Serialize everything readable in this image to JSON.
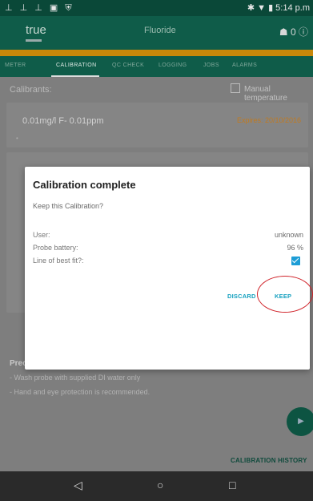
{
  "status_bar": {
    "left_icons": "⊥ ⊥ ⊥ ▣ ⛨",
    "right_text": "✱ ▼ ▮ 5:14 p.m"
  },
  "app_bar": {
    "logo": "true",
    "title": "Fluoride",
    "actions": "☗ 0  ⓘ"
  },
  "tabs": [
    {
      "label": "METER"
    },
    {
      "label": "CALIBRATION"
    },
    {
      "label": "QC CHECK"
    },
    {
      "label": "LOGGING"
    },
    {
      "label": "JOBS"
    },
    {
      "label": "ALARMS"
    }
  ],
  "content": {
    "calibrants_label": "Calibrants:",
    "manual_temperature_label": "Manual temperature",
    "calibrant_text": "0.01mg/l F- 0.01ppm",
    "calibrant_expiry": "Expires: 20/10/2016",
    "precautions_title": "Precautions",
    "precautions": [
      "- Wash probe with supplied DI water only",
      "- Hand and eye protection is recommended."
    ],
    "calibration_history": "CALIBRATION HISTORY"
  },
  "dialog": {
    "title": "Calibration complete",
    "question": "Keep this Calibration?",
    "rows": [
      {
        "label": "User:",
        "value": "unknown"
      },
      {
        "label": "Probe battery:",
        "value": "96 %"
      },
      {
        "label": "Line of best fit?:",
        "value": ""
      }
    ],
    "discard_label": "DISCARD",
    "keep_label": "KEEP",
    "line_of_best_fit_checked": true
  },
  "navbar": {
    "back": "◁",
    "home": "○",
    "recents": "□"
  },
  "colors": {
    "app_bar": "#0f5c49",
    "accent_orange": "#c8880a",
    "button_blue": "#14a0bf",
    "annotation_red": "#d0232a"
  }
}
